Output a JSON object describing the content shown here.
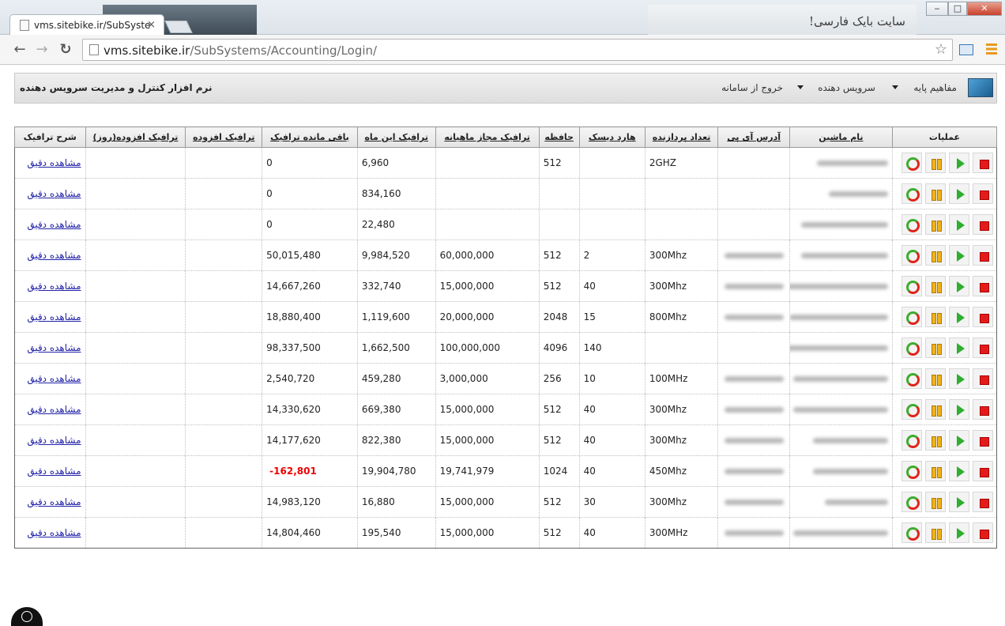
{
  "browser": {
    "tab_title": "vms.sitebike.ir/SubSystem",
    "url_host": "vms.sitebike.ir",
    "url_path": "/SubSystems/Accounting/Login/",
    "banner_text": "سایت بایک فارسی!",
    "tab_close": "×",
    "win_min": "‒",
    "win_max": "□",
    "win_close": "✕",
    "nav_back": "←",
    "nav_forward": "→",
    "nav_reload": "↻",
    "star": "☆"
  },
  "app": {
    "title": "نرم افزار کنترل و مدیریت سرویس دهنده",
    "menu": {
      "basics": "مفاهیم پایه",
      "service_provider": "سرویس دهنده",
      "logout": "خروج از سامانه"
    }
  },
  "table": {
    "headers": {
      "ops": "عملیات",
      "name": "نام ماشین",
      "ip": "آدرس آی پی",
      "cpu": "تعداد پردازنده",
      "hdd": "هارد دیسک",
      "ram": "حافظه",
      "allowed": "ترافیک مجاز ماهیانه",
      "this_month": "ترافیک این ماه",
      "remaining": "باقی مانده ترافیک",
      "extra": "ترافیک افزوده",
      "extra_day": "ترافیک افزوده(روز)",
      "desc": "شرح ترافیک"
    },
    "link_label": "مشاهده دقیق",
    "rows": [
      {
        "name_w": 90,
        "ip_w": 0,
        "cpu": "2GHZ",
        "hdd": "",
        "ram": "512",
        "allowed": "",
        "this_month": "6,960",
        "remaining": "0",
        "neg": false
      },
      {
        "name_w": 75,
        "ip_w": 0,
        "cpu": "",
        "hdd": "",
        "ram": "",
        "allowed": "",
        "this_month": "834,160",
        "remaining": "0",
        "neg": false
      },
      {
        "name_w": 110,
        "ip_w": 0,
        "cpu": "",
        "hdd": "",
        "ram": "",
        "allowed": "",
        "this_month": "22,480",
        "remaining": "0",
        "neg": false
      },
      {
        "name_w": 110,
        "ip_w": 75,
        "cpu": "300Mhz",
        "hdd": "2",
        "ram": "512",
        "allowed": "60,000,000",
        "this_month": "9,984,520",
        "remaining": "50,015,480",
        "neg": false
      },
      {
        "name_w": 130,
        "ip_w": 75,
        "cpu": "300Mhz",
        "hdd": "40",
        "ram": "512",
        "allowed": "15,000,000",
        "this_month": "332,740",
        "remaining": "14,667,260",
        "neg": false
      },
      {
        "name_w": 125,
        "ip_w": 75,
        "cpu": "800Mhz",
        "hdd": "15",
        "ram": "2048",
        "allowed": "20,000,000",
        "this_month": "1,119,600",
        "remaining": "18,880,400",
        "neg": false
      },
      {
        "name_w": 165,
        "ip_w": 0,
        "cpu": "",
        "hdd": "140",
        "ram": "4096",
        "allowed": "100,000,000",
        "this_month": "1,662,500",
        "remaining": "98,337,500",
        "neg": false
      },
      {
        "name_w": 120,
        "ip_w": 75,
        "cpu": "100MHz",
        "hdd": "10",
        "ram": "256",
        "allowed": "3,000,000",
        "this_month": "459,280",
        "remaining": "2,540,720",
        "neg": false
      },
      {
        "name_w": 120,
        "ip_w": 75,
        "cpu": "300Mhz",
        "hdd": "40",
        "ram": "512",
        "allowed": "15,000,000",
        "this_month": "669,380",
        "remaining": "14,330,620",
        "neg": false
      },
      {
        "name_w": 95,
        "ip_w": 75,
        "cpu": "300Mhz",
        "hdd": "40",
        "ram": "512",
        "allowed": "15,000,000",
        "this_month": "822,380",
        "remaining": "14,177,620",
        "neg": false
      },
      {
        "name_w": 95,
        "ip_w": 75,
        "cpu": "450Mhz",
        "hdd": "40",
        "ram": "1024",
        "allowed": "19,741,979",
        "this_month": "19,904,780",
        "remaining": "-162,801",
        "neg": true
      },
      {
        "name_w": 80,
        "ip_w": 75,
        "cpu": "300Mhz",
        "hdd": "30",
        "ram": "512",
        "allowed": "15,000,000",
        "this_month": "16,880",
        "remaining": "14,983,120",
        "neg": false
      },
      {
        "name_w": 120,
        "ip_w": 75,
        "cpu": "300MHz",
        "hdd": "40",
        "ram": "512",
        "allowed": "15,000,000",
        "this_month": "195,540",
        "remaining": "14,804,460",
        "neg": false
      }
    ]
  },
  "colors": {
    "negative": "#e00000",
    "link": "#2222aa",
    "stop": "#e31b1b",
    "play": "#2fae2f",
    "pause": "#f0b21a"
  }
}
